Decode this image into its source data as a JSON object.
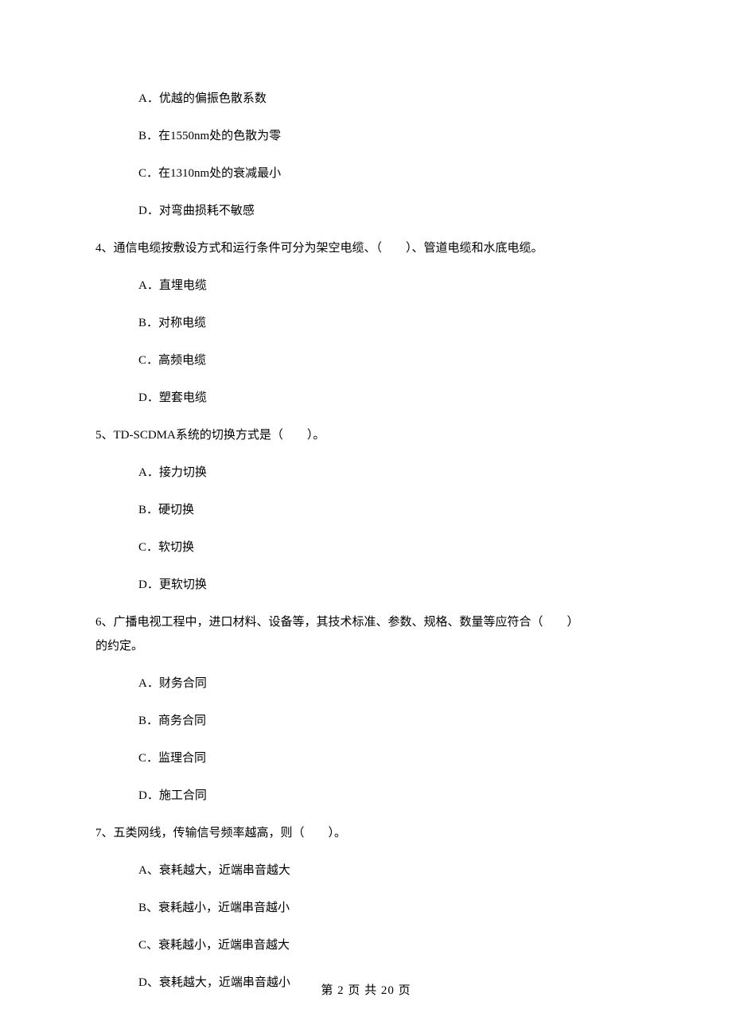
{
  "q3_options": {
    "a": "A．优越的偏振色散系数",
    "b": "B．在1550nm处的色散为零",
    "c": "C．在1310nm处的衰减最小",
    "d": "D．对弯曲损耗不敏感"
  },
  "q4": {
    "stem": "4、通信电缆按敷设方式和运行条件可分为架空电缆、（　　）、管道电缆和水底电缆。",
    "options": {
      "a": "A．直埋电缆",
      "b": "B．对称电缆",
      "c": "C．高频电缆",
      "d": "D．塑套电缆"
    }
  },
  "q5": {
    "stem": "5、TD-SCDMA系统的切换方式是（　　）。",
    "options": {
      "a": "A．接力切换",
      "b": "B．硬切换",
      "c": "C．软切换",
      "d": "D．更软切换"
    }
  },
  "q6": {
    "stem_line1": "6、广播电视工程中，进口材料、设备等，其技术标准、参数、规格、数量等应符合（　　）",
    "stem_line2": "的约定。",
    "options": {
      "a": "A．财务合同",
      "b": "B．商务合同",
      "c": "C．监理合同",
      "d": "D．施工合同"
    }
  },
  "q7": {
    "stem": "7、五类网线，传输信号频率越高，则（　　）。",
    "options": {
      "a": "A、衰耗越大，近端串音越大",
      "b": "B、衰耗越小，近端串音越小",
      "c": "C、衰耗越小，近端串音越大",
      "d": "D、衰耗越大，近端串音越小"
    }
  },
  "footer": "第 2 页 共 20 页"
}
